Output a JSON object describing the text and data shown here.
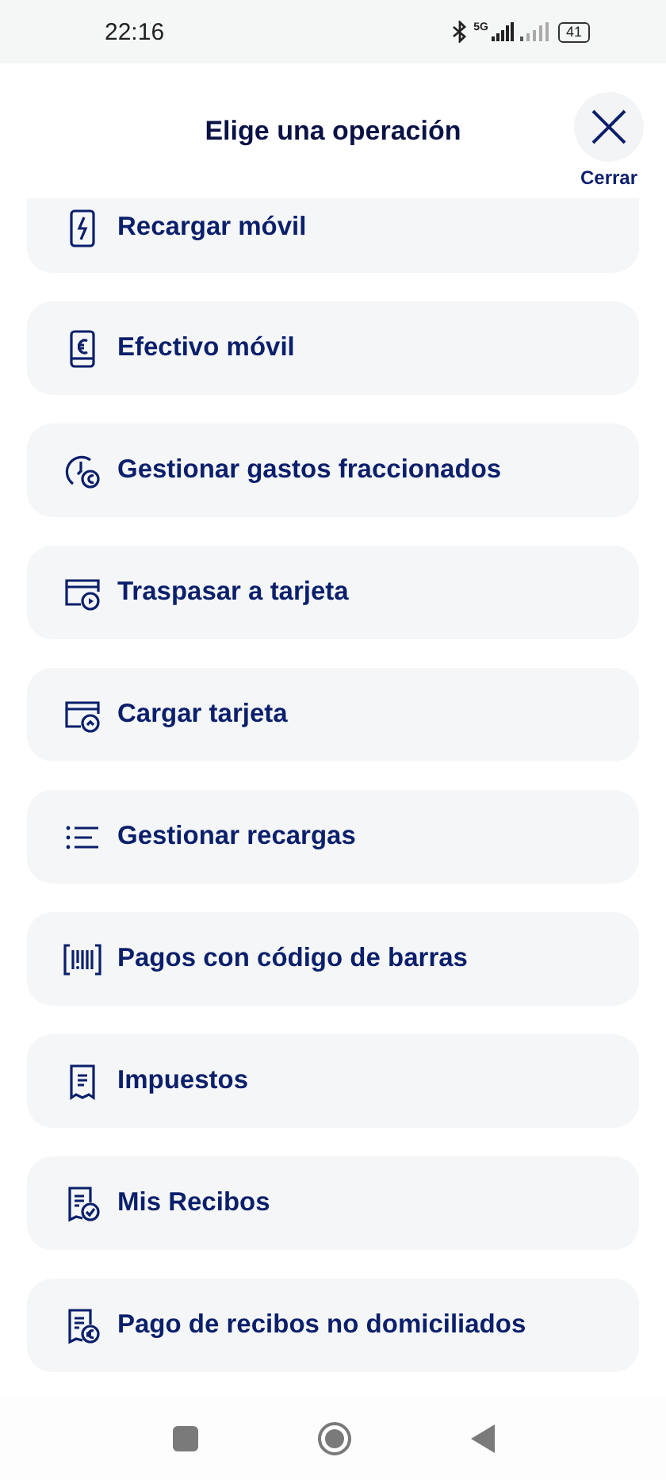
{
  "status_bar": {
    "time": "22:16",
    "network": "5G",
    "battery": "41"
  },
  "header": {
    "title": "Elige una operación",
    "close_label": "Cerrar"
  },
  "operations": [
    {
      "label": "Recargar móvil",
      "kind": "phone-bolt"
    },
    {
      "label": "Efectivo móvil",
      "kind": "phone-euro"
    },
    {
      "label": "Gestionar gastos fraccionados",
      "kind": "clock-euro"
    },
    {
      "label": "Traspasar a tarjeta",
      "kind": "card-play"
    },
    {
      "label": "Cargar tarjeta",
      "kind": "card-up"
    },
    {
      "label": "Gestionar recargas",
      "kind": "list"
    },
    {
      "label": "Pagos con código de barras",
      "kind": "barcode"
    },
    {
      "label": "Impuestos",
      "kind": "receipt"
    },
    {
      "label": "Mis Recibos",
      "kind": "receipt-check"
    },
    {
      "label": "Pago de recibos no domiciliados",
      "kind": "receipt-euro"
    }
  ]
}
